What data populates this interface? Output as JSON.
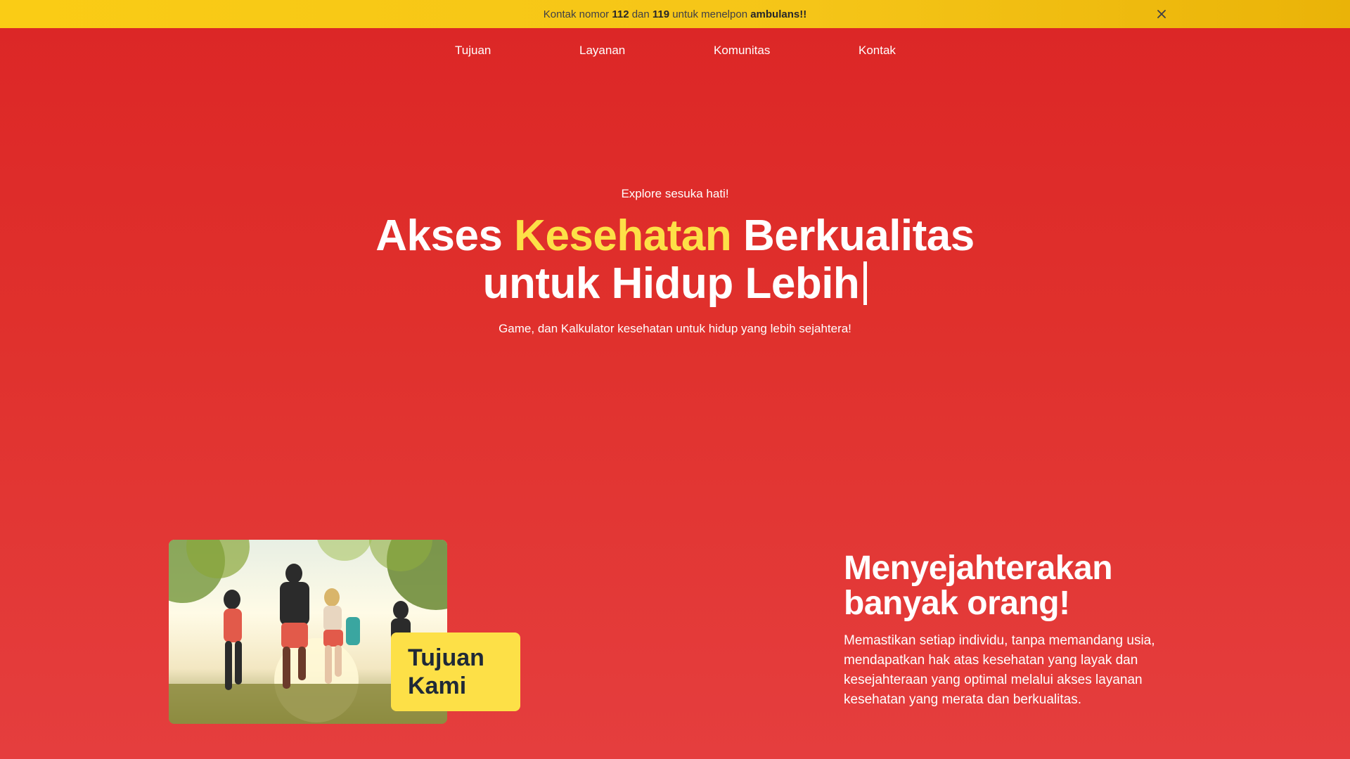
{
  "banner": {
    "t1": "Kontak nomor ",
    "n1": "112",
    "t2": " dan ",
    "n2": "119",
    "t3": " untuk menelpon ",
    "emph": "ambulans!!",
    "close_icon": "close-icon"
  },
  "nav": {
    "items": [
      "Tujuan",
      "Layanan",
      "Komunitas",
      "Kontak"
    ]
  },
  "hero": {
    "kicker": "Explore sesuka hati!",
    "title_part1": "Akses ",
    "title_accent": "Kesehatan",
    "title_part2": " Berkualitas",
    "title_line2": "untuk Hidup Lebih",
    "subtitle": "Game, dan Kalkulator kesehatan untuk hidup yang lebih sejahtera!"
  },
  "goal": {
    "tag_line1": "Tujuan",
    "tag_line2": "Kami",
    "title_line1": "Menyejahterakan",
    "title_line2": "banyak orang!",
    "body": "Memastikan setiap individu, tanpa memandang usia, mendapatkan hak atas kesehatan yang layak dan kesejahteraan yang optimal melalui akses layanan kesehatan yang merata dan berkualitas."
  },
  "colors": {
    "background": "#dc2626",
    "banner": "#facc15",
    "accent": "#fde047",
    "text": "#ffffff"
  }
}
